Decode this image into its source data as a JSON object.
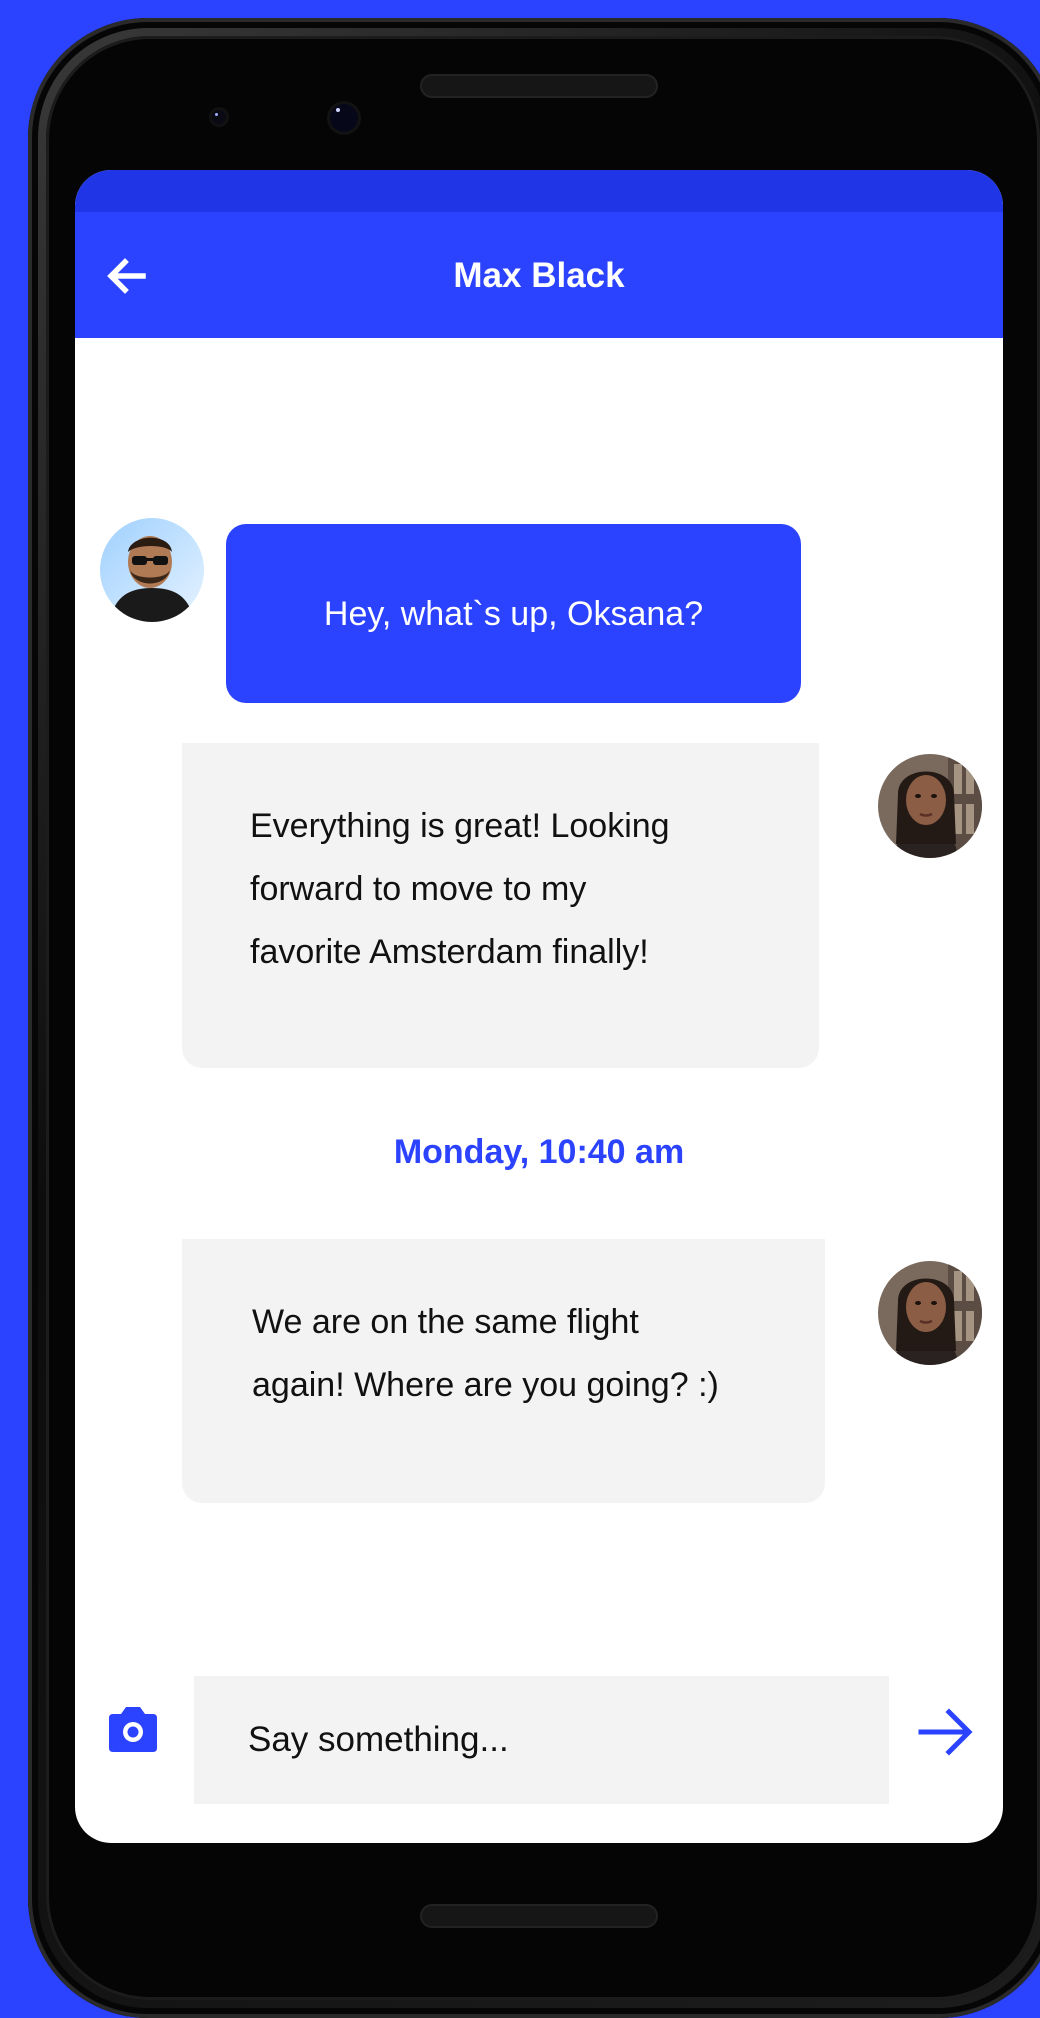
{
  "header": {
    "title": "Max Black"
  },
  "messages": [
    {
      "sender": "Max Black",
      "direction": "outgoing",
      "text": "Hey, what`s up, Oksana?"
    },
    {
      "sender": "Oksana",
      "direction": "incoming",
      "lines": [
        "Everything is great! Looking",
        "forward to move to my",
        "favorite Amsterdam finally!"
      ]
    },
    {
      "sender": "Oksana",
      "direction": "incoming",
      "lines": [
        "We are on the same flight",
        "again! Where are you going? :)"
      ]
    }
  ],
  "timestamp": "Monday, 10:40 am",
  "composer": {
    "placeholder": "Say something..."
  },
  "colors": {
    "accent": "#2b42ff",
    "status_bar": "#1f35e6",
    "incoming_bubble": "#f3f3f3",
    "background": "#ffffff"
  },
  "icons": {
    "back": "arrow-left-icon",
    "camera": "camera-icon",
    "send": "arrow-right-icon"
  }
}
